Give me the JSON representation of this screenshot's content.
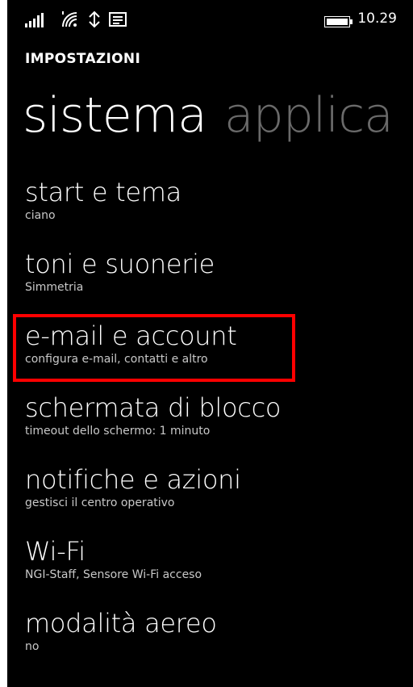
{
  "status_bar": {
    "time": "10.29",
    "icons": [
      "signal-icon",
      "wifi-icon",
      "data-icon",
      "message-icon",
      "battery-icon"
    ]
  },
  "app_title": "IMPOSTAZIONI",
  "pivot": {
    "tabs": [
      {
        "label": "sistema",
        "active": true
      },
      {
        "label": "applica",
        "active": false
      }
    ]
  },
  "settings": {
    "items": [
      {
        "title": "start e tema",
        "subtitle": "ciano"
      },
      {
        "title": "toni e suonerie",
        "subtitle": "Simmetria"
      },
      {
        "title": "e-mail e account",
        "subtitle": "configura e-mail, contatti e altro"
      },
      {
        "title": "schermata di blocco",
        "subtitle": "timeout dello schermo: 1 minuto"
      },
      {
        "title": "notifiche e azioni",
        "subtitle": "gestisci il centro operativo"
      },
      {
        "title": "Wi-Fi",
        "subtitle": "NGI-Staff, Sensore Wi-Fi acceso"
      },
      {
        "title": "modalità aereo",
        "subtitle": "no"
      }
    ]
  },
  "colors": {
    "background": "#000000",
    "text": "#ffffff",
    "inactive_tab": "#6a6a6a",
    "highlight": "#ff0000"
  }
}
